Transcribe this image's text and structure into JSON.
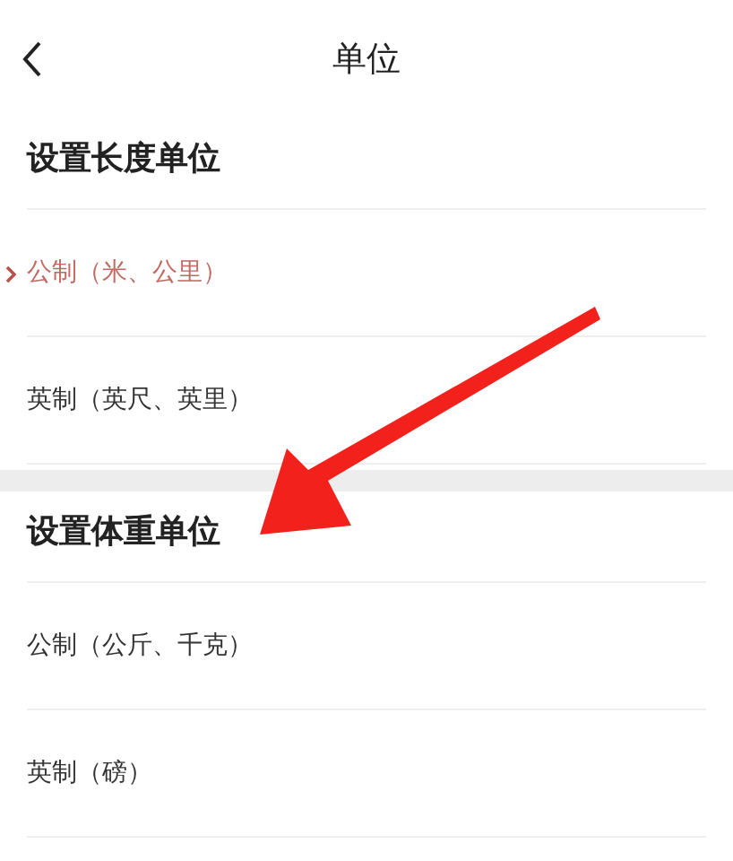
{
  "header": {
    "title": "单位"
  },
  "sections": [
    {
      "title": "设置长度单位",
      "options": [
        {
          "label": "公制（米、公里）",
          "selected": true
        },
        {
          "label": "英制（英尺、英里）",
          "selected": false
        }
      ]
    },
    {
      "title": "设置体重单位",
      "options": [
        {
          "label": "公制（公斤、千克）",
          "selected": false
        },
        {
          "label": "英制（磅）",
          "selected": false
        }
      ]
    }
  ],
  "annotation": {
    "kind": "arrow"
  }
}
